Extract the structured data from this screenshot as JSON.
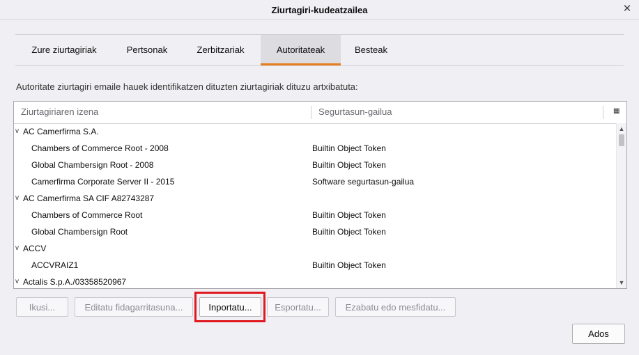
{
  "window": {
    "title": "Ziurtagiri-kudeatzailea",
    "close_icon": "close-icon"
  },
  "tabs": [
    {
      "label": "Zure ziurtagiriak",
      "selected": false
    },
    {
      "label": "Pertsonak",
      "selected": false
    },
    {
      "label": "Zerbitzariak",
      "selected": false
    },
    {
      "label": "Autoritateak",
      "selected": true
    },
    {
      "label": "Besteak",
      "selected": false
    }
  ],
  "description": "Autoritate ziurtagiri emaile hauek identifikatzen dituzten ziurtagiriak dituzu artxibatuta:",
  "tree": {
    "columns": {
      "name": "Ziurtagiriaren izena",
      "device": "Segurtasun-gailua"
    },
    "rows": [
      {
        "type": "group",
        "twisty": "v",
        "name": "AC Camerfirma S.A.",
        "token": ""
      },
      {
        "type": "child",
        "name": "Chambers of Commerce Root - 2008",
        "token": "Builtin Object Token"
      },
      {
        "type": "child",
        "name": "Global Chambersign Root - 2008",
        "token": "Builtin Object Token"
      },
      {
        "type": "child",
        "name": "Camerfirma Corporate Server II - 2015",
        "token": "Software segurtasun-gailua"
      },
      {
        "type": "group",
        "twisty": "v",
        "name": "AC Camerfirma SA CIF A82743287",
        "token": ""
      },
      {
        "type": "child",
        "name": "Chambers of Commerce Root",
        "token": "Builtin Object Token"
      },
      {
        "type": "child",
        "name": "Global Chambersign Root",
        "token": "Builtin Object Token"
      },
      {
        "type": "group",
        "twisty": "v",
        "name": "ACCV",
        "token": ""
      },
      {
        "type": "child",
        "name": "ACCVRAIZ1",
        "token": "Builtin Object Token"
      },
      {
        "type": "group",
        "twisty": "v",
        "name": "Actalis S.p.A./03358520967",
        "token": ""
      }
    ]
  },
  "buttons": {
    "view": "Ikusi...",
    "edit_trust": "Editatu fidagarritasuna...",
    "import": "Inportatu...",
    "export": "Esportatu...",
    "delete": "Ezabatu edo mesfidatu...",
    "ok": "Ados"
  },
  "colors": {
    "selected_tab_accent": "#e87d1e",
    "highlight_box": "#e0181f"
  }
}
